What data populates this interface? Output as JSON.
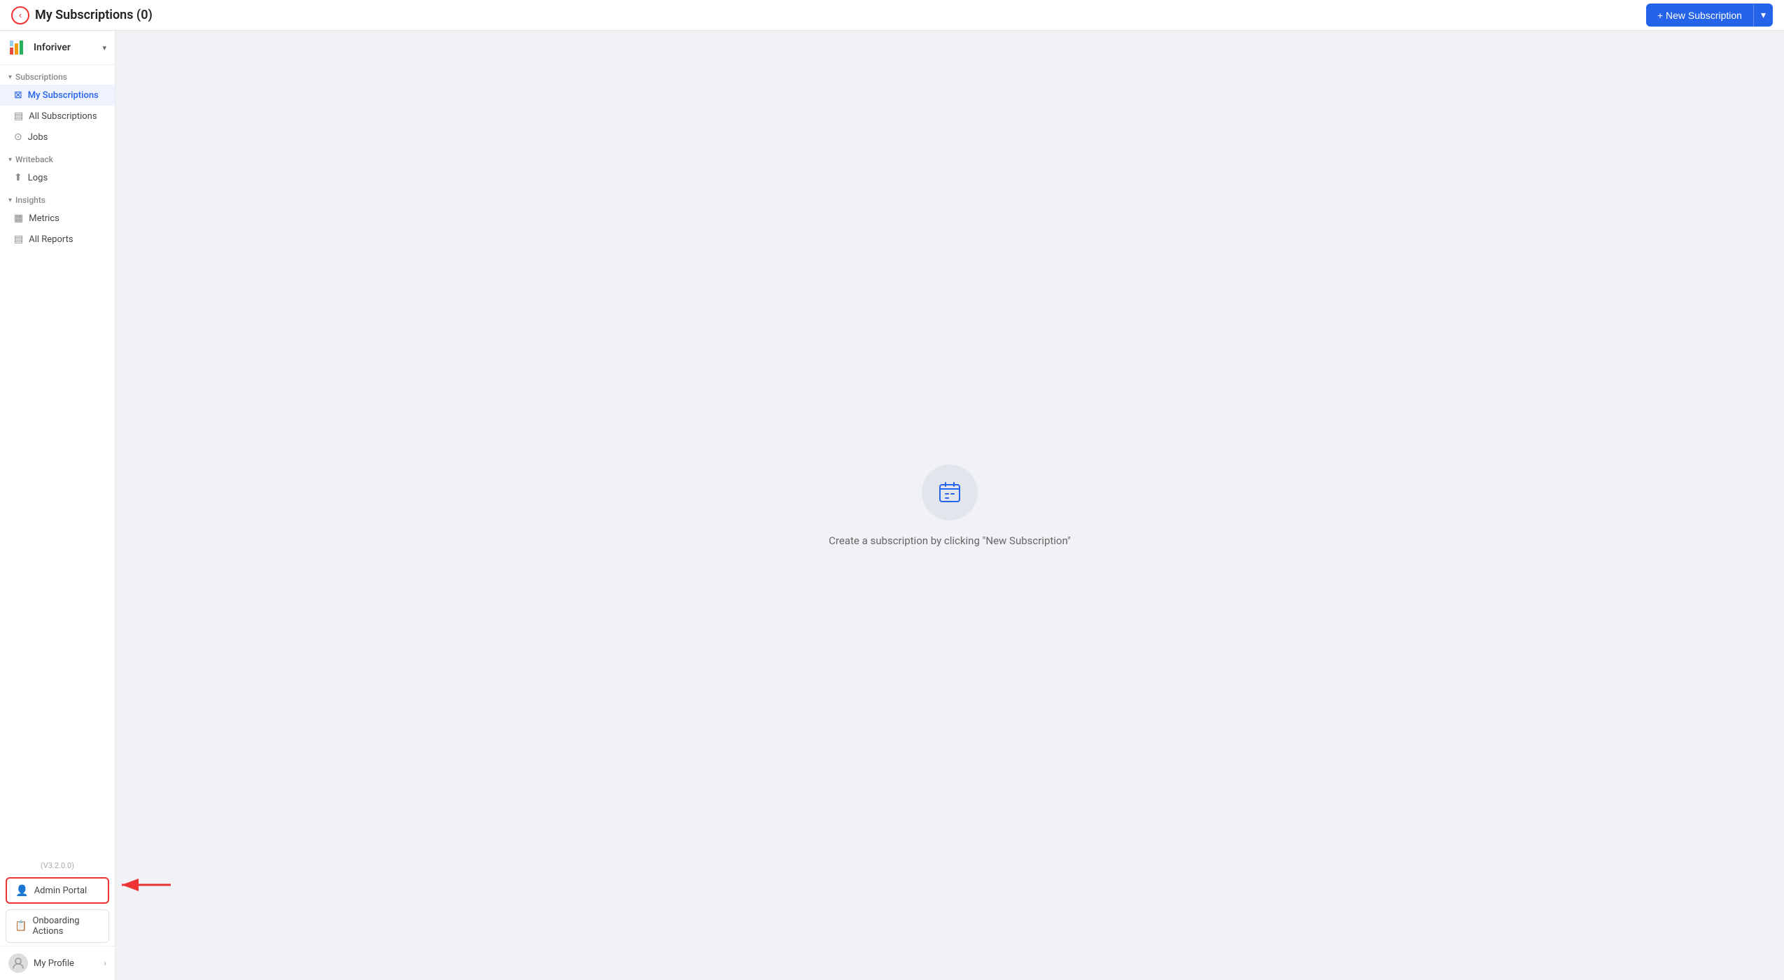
{
  "topbar": {
    "title": "My Subscriptions (0)",
    "back_label": "‹",
    "new_subscription_label": "+ New Subscription",
    "new_subscription_dropdown": "▾"
  },
  "sidebar": {
    "brand_name": "Inforiver",
    "chevron": "▾",
    "sections": [
      {
        "label": "Subscriptions",
        "items": [
          {
            "id": "my-subscriptions",
            "label": "My Subscriptions",
            "icon": "⊠",
            "active": true
          },
          {
            "id": "all-subscriptions",
            "label": "All Subscriptions",
            "icon": "▤"
          },
          {
            "id": "jobs",
            "label": "Jobs",
            "icon": "⊙"
          }
        ]
      },
      {
        "label": "Writeback",
        "items": [
          {
            "id": "logs",
            "label": "Logs",
            "icon": "⬆"
          }
        ]
      },
      {
        "label": "Insights",
        "items": [
          {
            "id": "metrics",
            "label": "Metrics",
            "icon": "▦"
          },
          {
            "id": "all-reports",
            "label": "All Reports",
            "icon": "▤"
          }
        ]
      }
    ],
    "version": "(V3.2.0.0)",
    "admin_portal_label": "Admin Portal",
    "onboarding_label": "Onboarding Actions",
    "profile_label": "My Profile"
  },
  "main": {
    "empty_state_text": "Create a subscription by clicking \"New Subscription\""
  }
}
